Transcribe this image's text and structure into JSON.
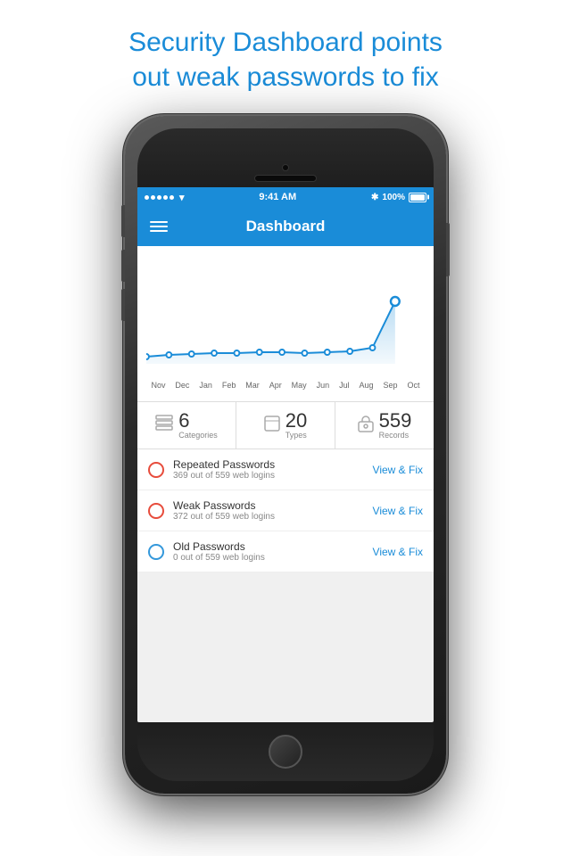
{
  "page": {
    "header_line1": "Security Dashboard points",
    "header_line2": "out weak passwords to fix"
  },
  "status_bar": {
    "time": "9:41 AM",
    "battery_percent": "100%",
    "bluetooth": "⁎"
  },
  "nav": {
    "title": "Dashboard"
  },
  "chart": {
    "x_labels": [
      "Nov",
      "Dec",
      "Jan",
      "Feb",
      "Mar",
      "Apr",
      "May",
      "Jun",
      "Jul",
      "Aug",
      "Sep",
      "Oct"
    ]
  },
  "stats": [
    {
      "icon": "☰",
      "number": "6",
      "label": "Categories"
    },
    {
      "icon": "⬜",
      "number": "20",
      "label": "Types"
    },
    {
      "icon": "🔒",
      "number": "559",
      "label": "Records"
    }
  ],
  "security_items": [
    {
      "status": "red",
      "title": "Repeated Passwords",
      "subtitle": "369 out of 559 web logins",
      "action": "View & Fix"
    },
    {
      "status": "red",
      "title": "Weak Passwords",
      "subtitle": "372 out of 559 web logins",
      "action": "View & Fix"
    },
    {
      "status": "blue",
      "title": "Old Passwords",
      "subtitle": "0 out of 559 web logins",
      "action": "View & Fix"
    }
  ],
  "colors": {
    "brand_blue": "#1a8cd8",
    "red_status": "#e74c3c",
    "blue_status": "#3498db"
  }
}
